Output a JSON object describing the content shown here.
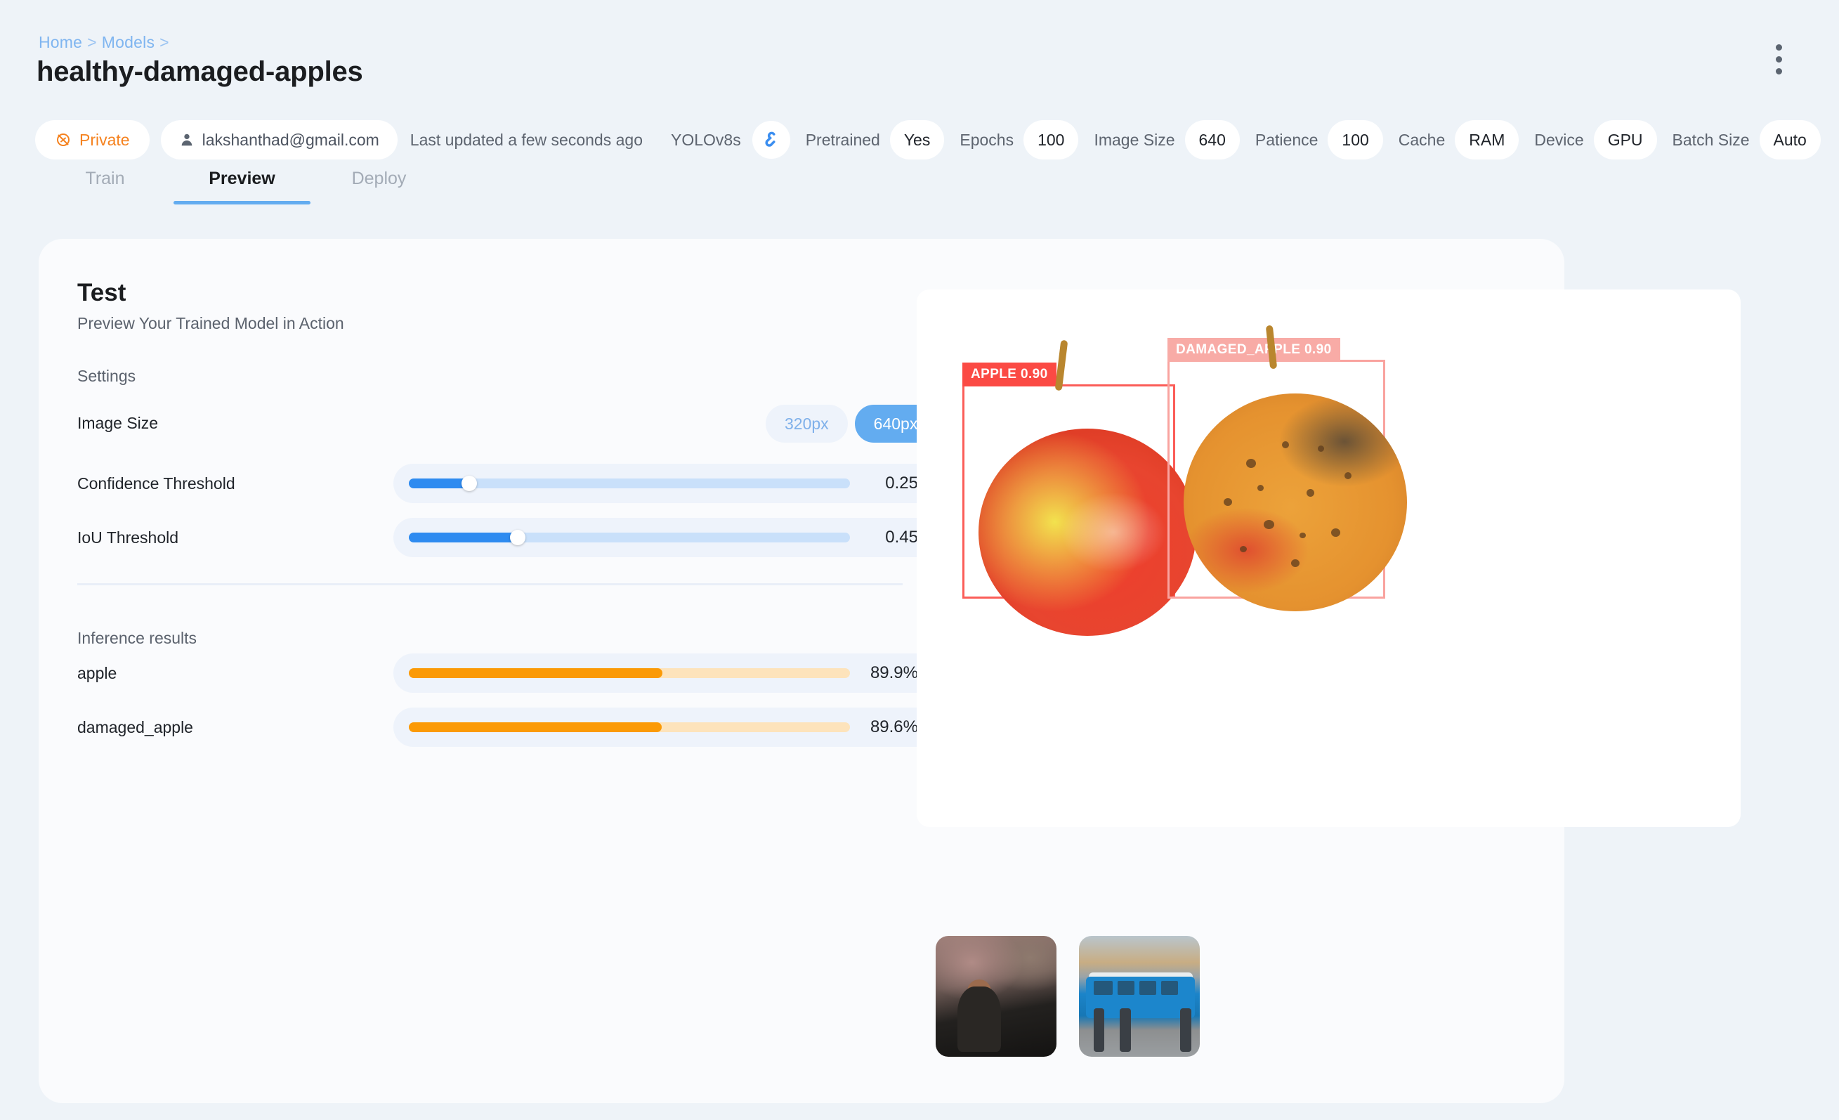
{
  "breadcrumb": {
    "home": "Home",
    "models": "Models",
    "separator": ">"
  },
  "header": {
    "title": "healthy-damaged-apples",
    "kebab_menu": "more-options"
  },
  "chips": {
    "visibility": "Private",
    "owner_email": "lakshanthad@gmail.com",
    "last_updated": "Last updated a few seconds ago",
    "model_name": "YOLOv8s",
    "params": [
      {
        "key": "Pretrained",
        "value": "Yes"
      },
      {
        "key": "Epochs",
        "value": "100"
      },
      {
        "key": "Image Size",
        "value": "640"
      },
      {
        "key": "Patience",
        "value": "100"
      },
      {
        "key": "Cache",
        "value": "RAM"
      },
      {
        "key": "Device",
        "value": "GPU"
      },
      {
        "key": "Batch Size",
        "value": "Auto"
      }
    ]
  },
  "tabs": [
    {
      "label": "Train",
      "active": false
    },
    {
      "label": "Preview",
      "active": true
    },
    {
      "label": "Deploy",
      "active": false
    }
  ],
  "test_panel": {
    "title": "Test",
    "subtitle": "Preview Your Trained Model in Action",
    "settings_label": "Settings",
    "image_size": {
      "label": "Image Size",
      "options": [
        "320px",
        "640px"
      ],
      "selected": "640px"
    },
    "confidence": {
      "label": "Confidence Threshold",
      "value": "0.25",
      "percent": 25
    },
    "iou": {
      "label": "IoU Threshold",
      "value": "0.45",
      "percent": 45
    }
  },
  "inference": {
    "heading": "Inference results",
    "results": [
      {
        "label": "apple",
        "value": "89.9%",
        "percent": 89.9
      },
      {
        "label": "damaged_apple",
        "value": "89.6%",
        "percent": 89.6
      }
    ]
  },
  "detections": [
    {
      "label": "APPLE 0.90",
      "class": "apple",
      "confidence": "0.90"
    },
    {
      "label": "DAMAGED_APPLE 0.90",
      "class": "damaged_apple",
      "confidence": "0.90"
    }
  ],
  "thumbnails": [
    {
      "name": "thumbnail-football-managers"
    },
    {
      "name": "thumbnail-street-bus"
    }
  ],
  "colors": {
    "accent_blue": "#63acf0",
    "orange": "#f5821f",
    "bar_orange": "#fb9a06",
    "detection_red": "#fb4a44",
    "detection_pink": "#f8aba6",
    "page_bg": "#eef3f8",
    "card_bg": "#fafbfd"
  }
}
